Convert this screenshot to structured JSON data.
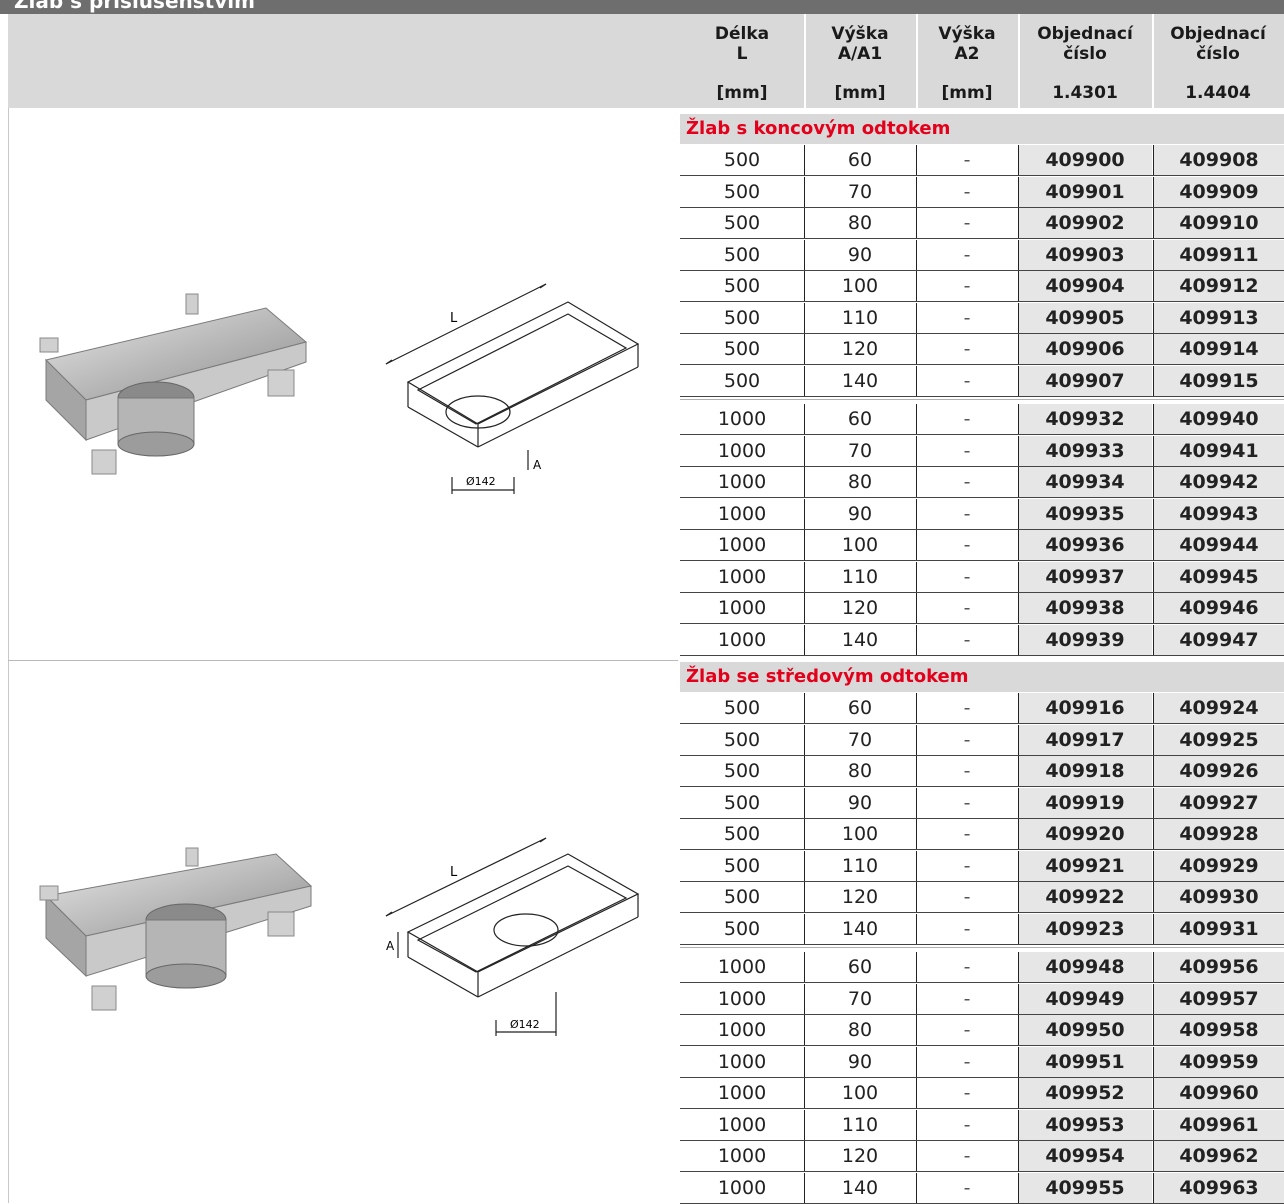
{
  "header": {
    "top_title": "Žlab s příslušenstvím",
    "columns": [
      {
        "line1": "Délka",
        "line2": "L",
        "unit": "[mm]"
      },
      {
        "line1": "Výška",
        "line2": "A/A1",
        "unit": "[mm]"
      },
      {
        "line1": "Výška",
        "line2": "A2",
        "unit": "[mm]"
      },
      {
        "line1": "Objednací",
        "line2": "číslo",
        "unit": "1.4301"
      },
      {
        "line1": "Objednací",
        "line2": "číslo",
        "unit": "1.4404"
      }
    ]
  },
  "sections": [
    {
      "title": "Žlab s koncovým odtokem",
      "drawing_labels": {
        "length": "L",
        "height": "A",
        "diameter": "Ø142"
      },
      "rows": [
        [
          "500",
          "60",
          "-",
          "409900",
          "409908"
        ],
        [
          "500",
          "70",
          "-",
          "409901",
          "409909"
        ],
        [
          "500",
          "80",
          "-",
          "409902",
          "409910"
        ],
        [
          "500",
          "90",
          "-",
          "409903",
          "409911"
        ],
        [
          "500",
          "100",
          "-",
          "409904",
          "409912"
        ],
        [
          "500",
          "110",
          "-",
          "409905",
          "409913"
        ],
        [
          "500",
          "120",
          "-",
          "409906",
          "409914"
        ],
        [
          "500",
          "140",
          "-",
          "409907",
          "409915"
        ],
        [
          "1000",
          "60",
          "-",
          "409932",
          "409940"
        ],
        [
          "1000",
          "70",
          "-",
          "409933",
          "409941"
        ],
        [
          "1000",
          "80",
          "-",
          "409934",
          "409942"
        ],
        [
          "1000",
          "90",
          "-",
          "409935",
          "409943"
        ],
        [
          "1000",
          "100",
          "-",
          "409936",
          "409944"
        ],
        [
          "1000",
          "110",
          "-",
          "409937",
          "409945"
        ],
        [
          "1000",
          "120",
          "-",
          "409938",
          "409946"
        ],
        [
          "1000",
          "140",
          "-",
          "409939",
          "409947"
        ]
      ]
    },
    {
      "title": "Žlab se středovým odtokem",
      "drawing_labels": {
        "length": "L",
        "height": "A",
        "diameter": "Ø142"
      },
      "rows": [
        [
          "500",
          "60",
          "-",
          "409916",
          "409924"
        ],
        [
          "500",
          "70",
          "-",
          "409917",
          "409925"
        ],
        [
          "500",
          "80",
          "-",
          "409918",
          "409926"
        ],
        [
          "500",
          "90",
          "-",
          "409919",
          "409927"
        ],
        [
          "500",
          "100",
          "-",
          "409920",
          "409928"
        ],
        [
          "500",
          "110",
          "-",
          "409921",
          "409929"
        ],
        [
          "500",
          "120",
          "-",
          "409922",
          "409930"
        ],
        [
          "500",
          "140",
          "-",
          "409923",
          "409931"
        ],
        [
          "1000",
          "60",
          "-",
          "409948",
          "409956"
        ],
        [
          "1000",
          "70",
          "-",
          "409949",
          "409957"
        ],
        [
          "1000",
          "80",
          "-",
          "409950",
          "409958"
        ],
        [
          "1000",
          "90",
          "-",
          "409951",
          "409959"
        ],
        [
          "1000",
          "100",
          "-",
          "409952",
          "409960"
        ],
        [
          "1000",
          "110",
          "-",
          "409953",
          "409961"
        ],
        [
          "1000",
          "120",
          "-",
          "409954",
          "409962"
        ],
        [
          "1000",
          "140",
          "-",
          "409955",
          "409963"
        ]
      ]
    }
  ]
}
